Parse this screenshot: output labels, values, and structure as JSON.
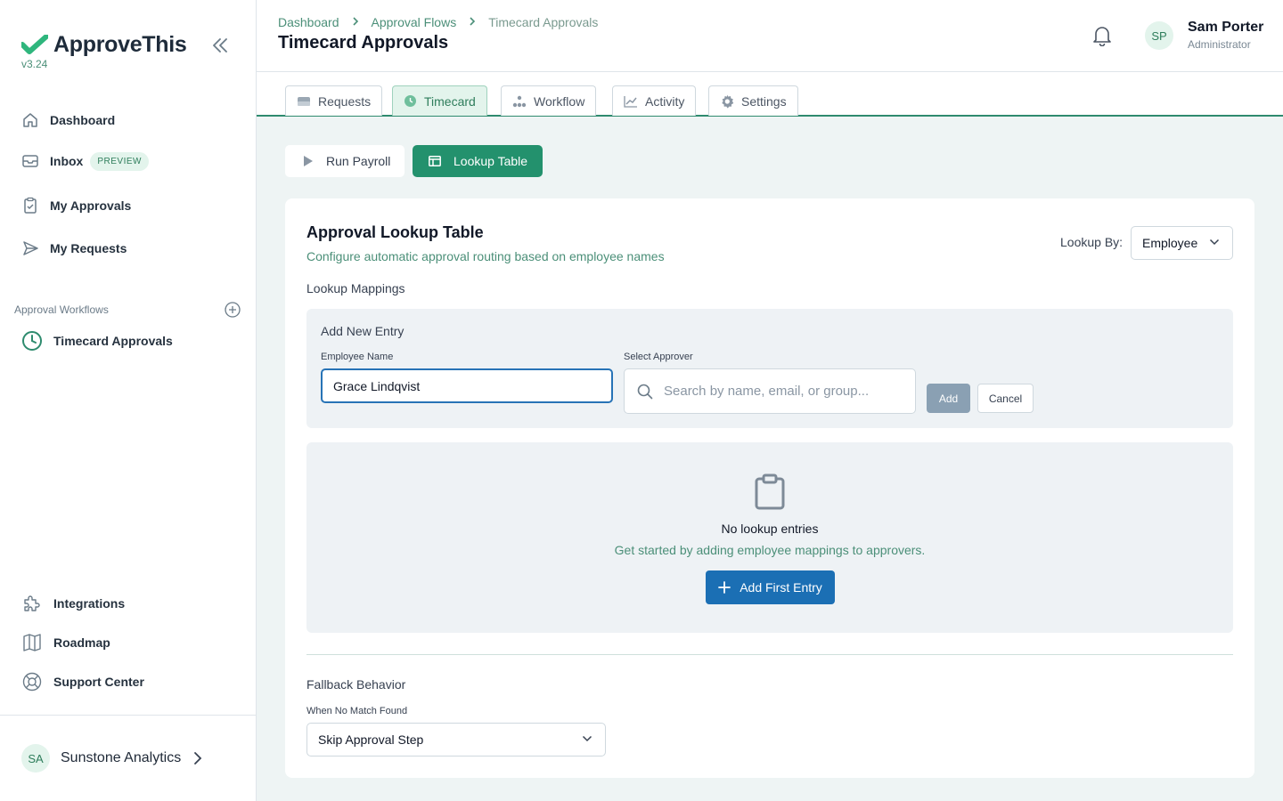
{
  "app": {
    "name": "ApproveThis",
    "version": "v3.24"
  },
  "sidebar": {
    "items": [
      {
        "label": "Dashboard"
      },
      {
        "label": "Inbox",
        "badge": "PREVIEW"
      },
      {
        "label": "My Approvals"
      },
      {
        "label": "My Requests"
      }
    ],
    "workflows_title": "Approval Workflows",
    "workflows": [
      {
        "label": "Timecard Approvals"
      }
    ],
    "bottom_items": [
      {
        "label": "Integrations"
      },
      {
        "label": "Roadmap"
      },
      {
        "label": "Support Center"
      }
    ],
    "org": {
      "initials": "SA",
      "name": "Sunstone Analytics"
    }
  },
  "header": {
    "breadcrumb": [
      "Dashboard",
      "Approval Flows",
      "Timecard Approvals"
    ],
    "title": "Timecard Approvals",
    "user": {
      "initials": "SP",
      "name": "Sam Porter",
      "role": "Administrator"
    }
  },
  "tabs": [
    {
      "label": "Requests",
      "icon": "inbox-icon",
      "active": false
    },
    {
      "label": "Timecard",
      "icon": "clock-icon",
      "active": true
    },
    {
      "label": "Workflow",
      "icon": "hierarchy-icon",
      "active": false
    },
    {
      "label": "Activity",
      "icon": "chart-icon",
      "active": false
    },
    {
      "label": "Settings",
      "icon": "gear-icon",
      "active": false
    }
  ],
  "subnav": {
    "run_payroll": "Run Payroll",
    "lookup_table": "Lookup Table"
  },
  "card": {
    "title": "Approval Lookup Table",
    "subtitle": "Configure automatic approval routing based on employee names",
    "lookup_by_label": "Lookup By:",
    "lookup_by_value": "Employee",
    "mappings_label": "Lookup Mappings",
    "add_entry": {
      "title": "Add New Entry",
      "employee_label": "Employee Name",
      "employee_value": "Grace Lindqvist",
      "approver_label": "Select Approver",
      "approver_placeholder": "Search by name, email, or group...",
      "add_label": "Add",
      "cancel_label": "Cancel"
    },
    "empty": {
      "title": "No lookup entries",
      "description": "Get started by adding employee mappings to approvers.",
      "button": "Add First Entry"
    },
    "fallback": {
      "title": "Fallback Behavior",
      "label": "When No Match Found",
      "value": "Skip Approval Step"
    }
  },
  "colors": {
    "brand": "#23916d",
    "primary_blue": "#1b6fb4",
    "accent_green": "#2e8b6e"
  }
}
